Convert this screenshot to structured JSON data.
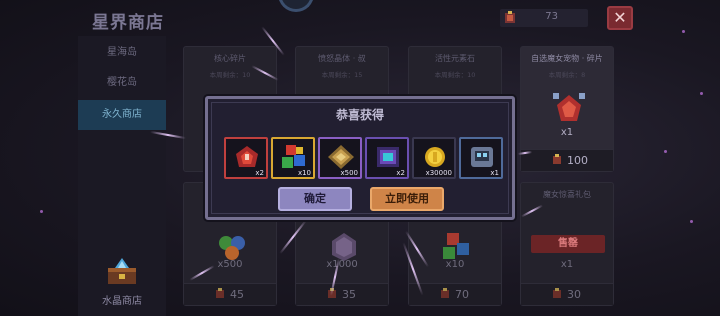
{
  "header": {
    "title": "星界商店",
    "currency_value": "73",
    "close_label": "✕"
  },
  "sidebar": {
    "tabs": [
      {
        "label": "星海岛"
      },
      {
        "label": "樱花岛"
      },
      {
        "label": "永久商店"
      }
    ],
    "active_tab": "永久商店",
    "crystal_shop_label": "水晶商店"
  },
  "shop": {
    "top_row": [
      {
        "name": "核心碎片",
        "stock": "本周剩余：10"
      },
      {
        "name": "愤怒晶体 · 叔",
        "stock": "本周剩余：15"
      },
      {
        "name": "活性元素石",
        "stock": "本周剩余：10"
      },
      {
        "name": "自选魔女宠物 · 碎片",
        "stock": "本周剩余：8",
        "qty": "x1",
        "price": "100"
      }
    ],
    "bottom_row": [
      {
        "qty": "x500",
        "price": "45"
      },
      {
        "qty": "x1000",
        "price": "35"
      },
      {
        "qty": "x10",
        "price": "70"
      },
      {
        "name": "魔女惊喜礼包",
        "qty": "x1",
        "price": "30",
        "badge": "售罄"
      }
    ]
  },
  "modal": {
    "title": "恭喜获得",
    "rewards": [
      {
        "icon": "red-gem-core-icon",
        "count": "x2",
        "border": "#c0403e"
      },
      {
        "icon": "elemental-cubes-icon",
        "count": "x10",
        "border": "#d9a832"
      },
      {
        "icon": "golden-rune-frame-icon",
        "count": "x500",
        "border": "#8a5fc4"
      },
      {
        "icon": "purple-crystal-box-icon",
        "count": "x2",
        "border": "#6a4fb0"
      },
      {
        "icon": "gold-coin-icon",
        "count": "x30000",
        "border": "#3a3850"
      },
      {
        "icon": "blue-robot-chest-icon",
        "count": "x1",
        "border": "#4f6a9a"
      }
    ],
    "confirm_label": "确定",
    "use_label": "立即使用"
  }
}
